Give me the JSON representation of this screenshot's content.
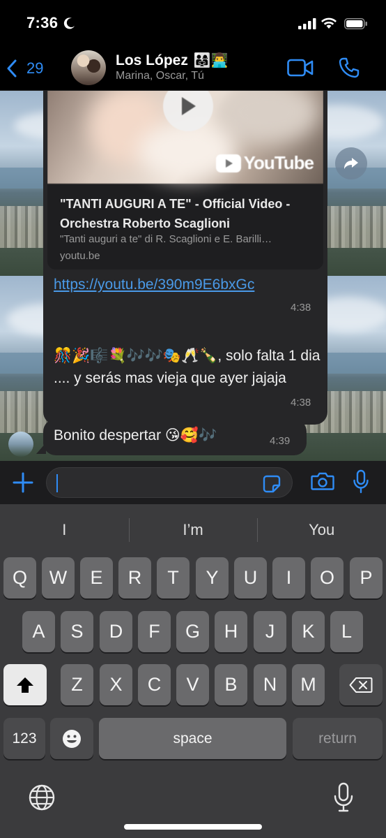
{
  "status_bar": {
    "time": "7:36"
  },
  "header": {
    "back_count": "29",
    "title": "Los López",
    "title_emoji": "👨‍👩‍👧👨‍💻",
    "members": "Marina, Oscar, Tú"
  },
  "messages": {
    "link_preview": {
      "title": "\"TANTI AUGURI A TE\" - Official Video - Orchestra Roberto Scaglioni",
      "description": "\"Tanti auguri a te\" di R. Scaglioni e E. Barilli…",
      "domain": "youtu.be",
      "youtube_label": "YouTube"
    },
    "link_url": "https://youtu.be/390m9E6bxGc",
    "link_time": "4:38",
    "msg2_text": "🎊🎉🎼💐🎶🎶🎭🥂🍾,  solo falta 1 dia .... y serás mas vieja que ayer  jajaja",
    "msg2_time": "4:38",
    "msg3_text": "Bonito despertar 😘🥰🎶",
    "msg3_time": "4:39"
  },
  "keyboard": {
    "suggestions": [
      "I",
      "I’m",
      "You"
    ],
    "row1": [
      "Q",
      "W",
      "E",
      "R",
      "T",
      "Y",
      "U",
      "I",
      "O",
      "P"
    ],
    "row2": [
      "A",
      "S",
      "D",
      "F",
      "G",
      "H",
      "J",
      "K",
      "L"
    ],
    "row3": [
      "Z",
      "X",
      "C",
      "V",
      "B",
      "N",
      "M"
    ],
    "num_key": "123",
    "space_key": "space",
    "return_key": "return"
  },
  "colors": {
    "accent": "#2f8cf5",
    "bubble": "#262628",
    "link": "#4a9ae8"
  }
}
